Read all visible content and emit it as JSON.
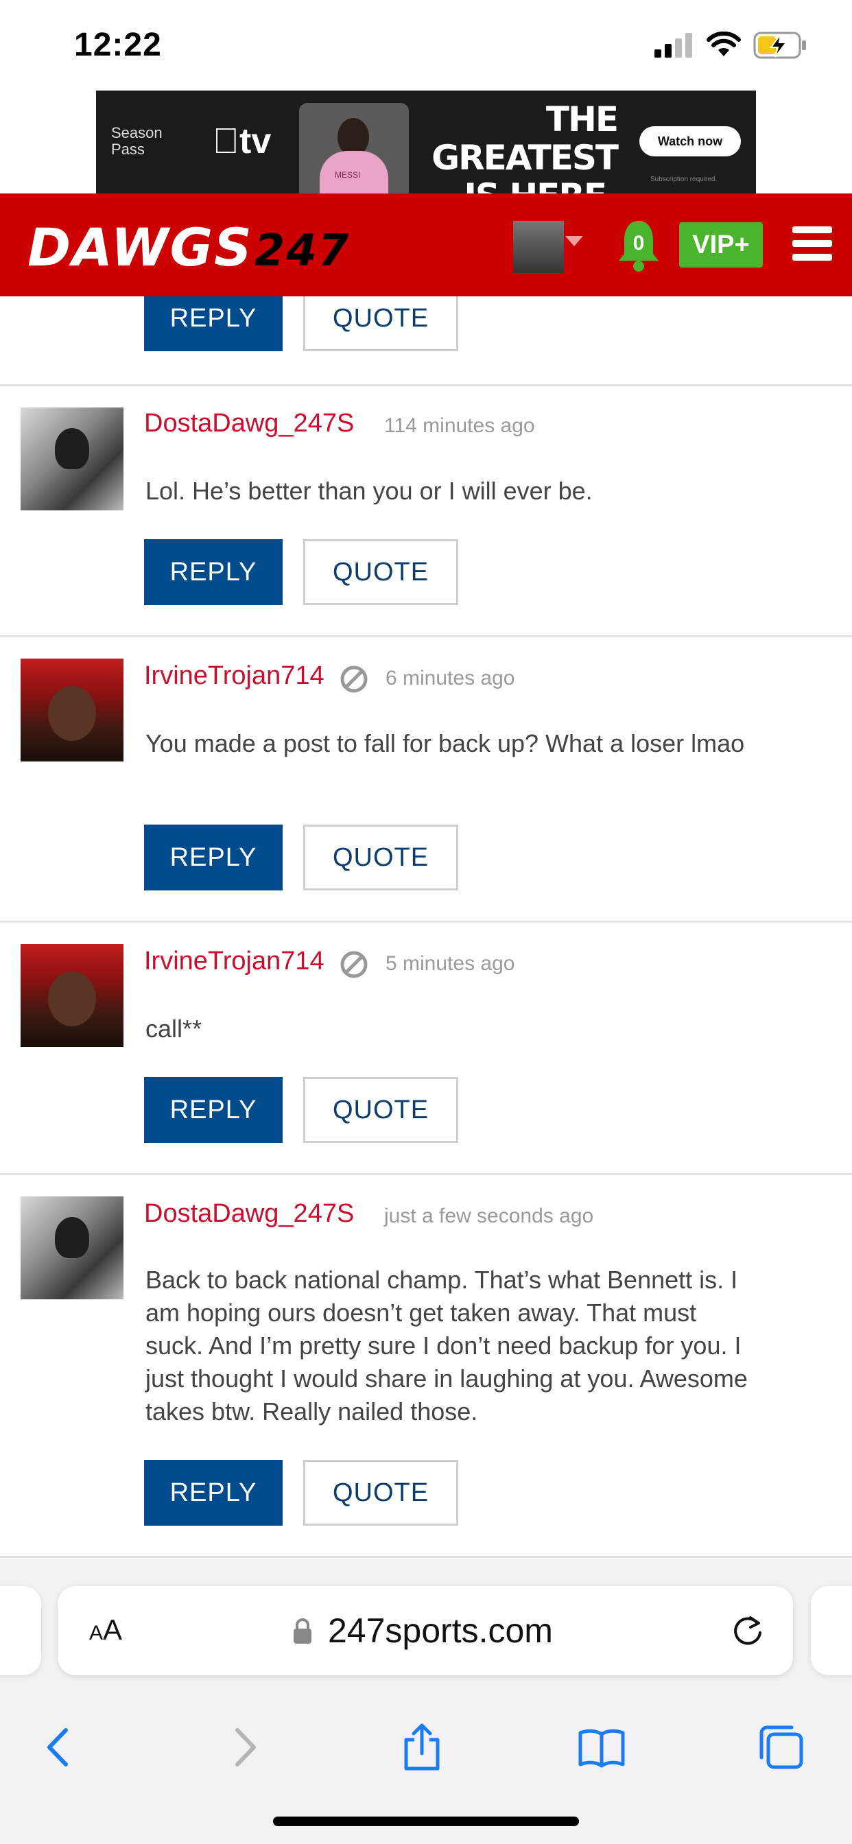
{
  "status_bar": {
    "time": "12:22"
  },
  "ad": {
    "brand_line1": "Season",
    "brand_line2": "Pass",
    "tv": "tv",
    "jersey_name": "MESSI",
    "headline_line1": "THE GREATEST",
    "headline_line2": "IS HERE.",
    "cta": "Watch now",
    "fine_print": "Subscription required."
  },
  "header": {
    "logo_text": "DAWGS",
    "logo_number": "247",
    "notification_count": "0",
    "vip_label": "VIP+"
  },
  "buttons": {
    "reply": "REPLY",
    "quote": "QUOTE"
  },
  "comments": [
    {
      "username": "DostaDawg_247S",
      "time": "114 minutes ago",
      "text": "Lol. He’s better than you or I will ever be."
    },
    {
      "username": "IrvineTrojan714",
      "time": "6 minutes ago",
      "text": "You made a post to fall for back up? What a loser lmao"
    },
    {
      "username": "IrvineTrojan714",
      "time": "5 minutes ago",
      "text": "call**"
    },
    {
      "username": "DostaDawg_247S",
      "time": "just a few seconds ago",
      "text": "Back to back national champ. That’s what Bennett is. I am hoping ours doesn’t get taken away. That must suck. And I’m pretty sure I don’t need backup for you. I just thought I would share in laughing at you. Awesome takes btw. Really nailed those."
    }
  ],
  "browser": {
    "aa_label_big": "A",
    "aa_label_small": "A",
    "url": "247sports.com"
  }
}
